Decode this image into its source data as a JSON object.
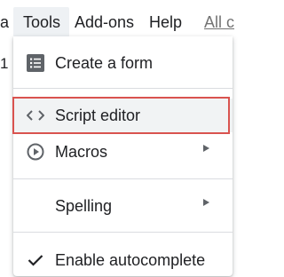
{
  "menubar": {
    "fragment_label": "a",
    "tools_label": "Tools",
    "addons_label": "Add-ons",
    "help_label": "Help",
    "all_changes_label": "All c"
  },
  "sheet": {
    "cell_fragment": "1"
  },
  "tools_menu": {
    "items": [
      {
        "label": "Create a form",
        "icon": "form-icon"
      },
      {
        "label": "Script editor",
        "icon": "code-icon",
        "highlighted": true
      },
      {
        "label": "Macros",
        "icon": "play-circle-icon",
        "has_submenu": true
      },
      {
        "label": "Spelling",
        "icon": "",
        "has_submenu": true
      },
      {
        "label": "Enable autocomplete",
        "icon": "check-icon",
        "checked": true
      }
    ]
  },
  "colors": {
    "highlight_border": "#d9534f",
    "hover_background": "#f1f3f4",
    "active_menu_background": "#eef1f4",
    "icon_color": "#5f6368",
    "text_color": "#202124"
  }
}
